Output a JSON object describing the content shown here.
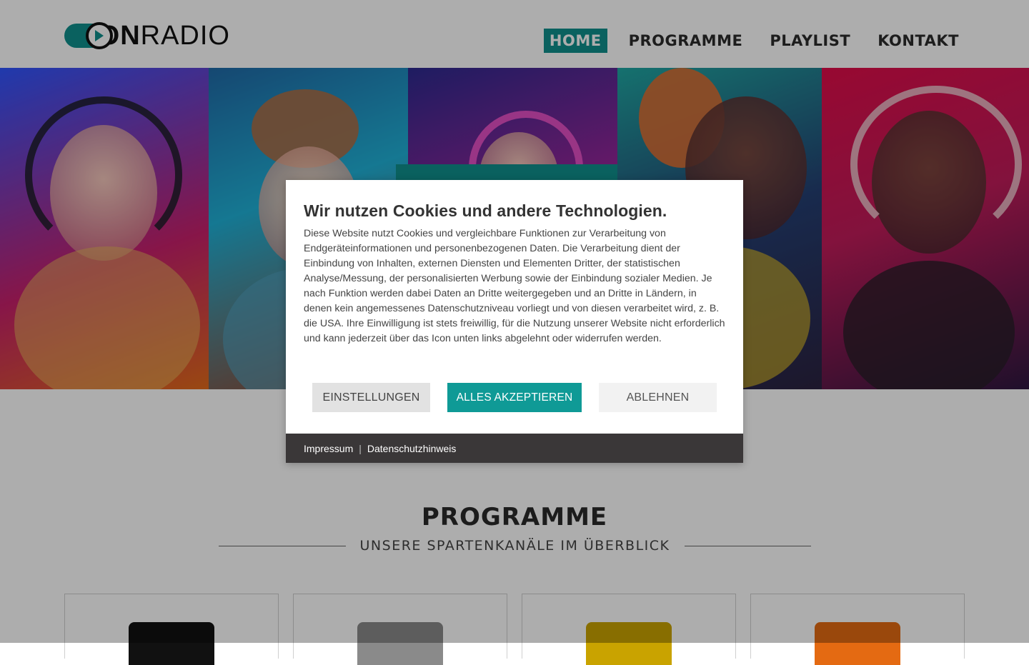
{
  "brand": {
    "logo_text_on": "ON",
    "logo_text_radio": "RADIO",
    "accent_color": "#0f8f8c"
  },
  "nav": {
    "items": [
      {
        "label": "HOME",
        "active": true
      },
      {
        "label": "PROGRAMME",
        "active": false
      },
      {
        "label": "PLAYLIST",
        "active": false
      },
      {
        "label": "KONTAKT",
        "active": false
      }
    ]
  },
  "section": {
    "title": "PROGRAMME",
    "subtitle": "UNSERE SPARTENKANÄLE IM ÜBERBLICK"
  },
  "cookie_dialog": {
    "title": "Wir nutzen Cookies und andere Technologien.",
    "body": "Diese Website nutzt Cookies und vergleichbare Funktionen zur Verarbeitung von Endgeräteinformationen und personenbezogenen Daten. Die Verarbeitung dient der Einbindung von Inhalten, externen Diensten und Elementen Dritter, der statistischen Analyse/Messung, der personalisierten Werbung sowie der Einbindung sozialer Medien. Je nach Funktion werden dabei Daten an Dritte weitergegeben und an Dritte in Ländern, in denen kein angemessenes Datenschutzniveau vorliegt und von diesen verarbeitet wird, z. B. die USA. Ihre Einwilligung ist stets freiwillig, für die Nutzung unserer Website nicht erforderlich und kann jederzeit über das Icon unten links abgelehnt oder widerrufen werden.",
    "buttons": {
      "settings": "EINSTELLUNGEN",
      "accept": "ALLES AKZEPTIEREN",
      "reject": "ABLEHNEN"
    },
    "footer": {
      "imprint": "Impressum",
      "separator": "|",
      "privacy": "Datenschutzhinweis"
    }
  },
  "program_card_colors": [
    "#111111",
    "#8a8a8a",
    "#c9a300",
    "#e46a12"
  ]
}
